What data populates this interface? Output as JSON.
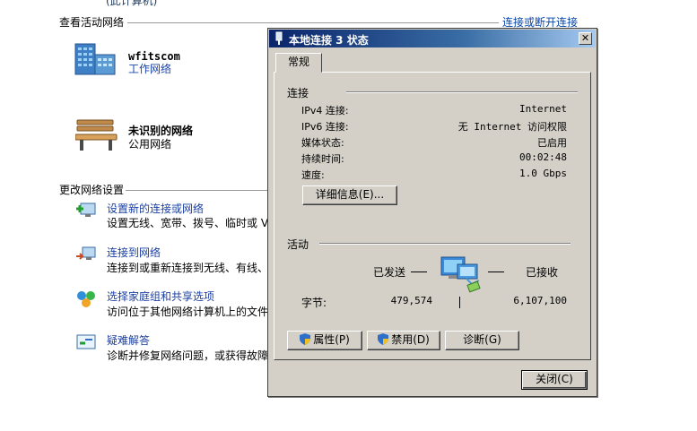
{
  "background": {
    "top_cut_text": "(此计算机)",
    "active_networks_header": "查看活动网络",
    "connect_disconnect_link": "连接或断开连接",
    "networks": [
      {
        "name": "wfitscom",
        "type": "工作网络",
        "icon": "office-building-icon"
      },
      {
        "name": "未识别的网络",
        "type": "公用网络",
        "icon": "park-bench-icon"
      }
    ],
    "change_settings_header": "更改网络设置",
    "tasks": [
      {
        "link": "设置新的连接或网络",
        "desc": "设置无线、宽带、拨号、临时或 V",
        "icon": "new-connection-icon"
      },
      {
        "link": "连接到网络",
        "desc": "连接到或重新连接到无线、有线、",
        "icon": "connect-network-icon"
      },
      {
        "link": "选择家庭组和共享选项",
        "desc": "访问位于其他网络计算机上的文件",
        "icon": "homegroup-icon"
      },
      {
        "link": "疑难解答",
        "desc": "诊断并修复网络问题，或获得故障",
        "icon": "troubleshoot-icon"
      }
    ]
  },
  "dialog": {
    "title": "本地连接 3 状态",
    "close_glyph": "✕",
    "tab_label": "常规",
    "connection": {
      "group_label": "连接",
      "rows": [
        {
          "label": "IPv4 连接:",
          "value": "Internet"
        },
        {
          "label": "IPv6 连接:",
          "value": "无 Internet 访问权限"
        },
        {
          "label": "媒体状态:",
          "value": "已启用"
        },
        {
          "label": "持续时间:",
          "value": "00:02:48"
        },
        {
          "label": "速度:",
          "value": "1.0 Gbps"
        }
      ],
      "details_button": "详细信息(E)..."
    },
    "activity": {
      "group_label": "活动",
      "sent_label": "已发送",
      "received_label": "已接收",
      "bytes_label": "字节:",
      "bytes_sent": "479,574",
      "bytes_received": "6,107,100"
    },
    "buttons": {
      "properties": "属性(P)",
      "disable": "禁用(D)",
      "diagnose": "诊断(G)",
      "close": "关闭(C)"
    }
  },
  "colors": {
    "title_gradient_start": "#0a246a",
    "title_gradient_end": "#a6caf0",
    "dialog_face": "#d4d0c8",
    "link_blue": "#1a3fa3"
  }
}
